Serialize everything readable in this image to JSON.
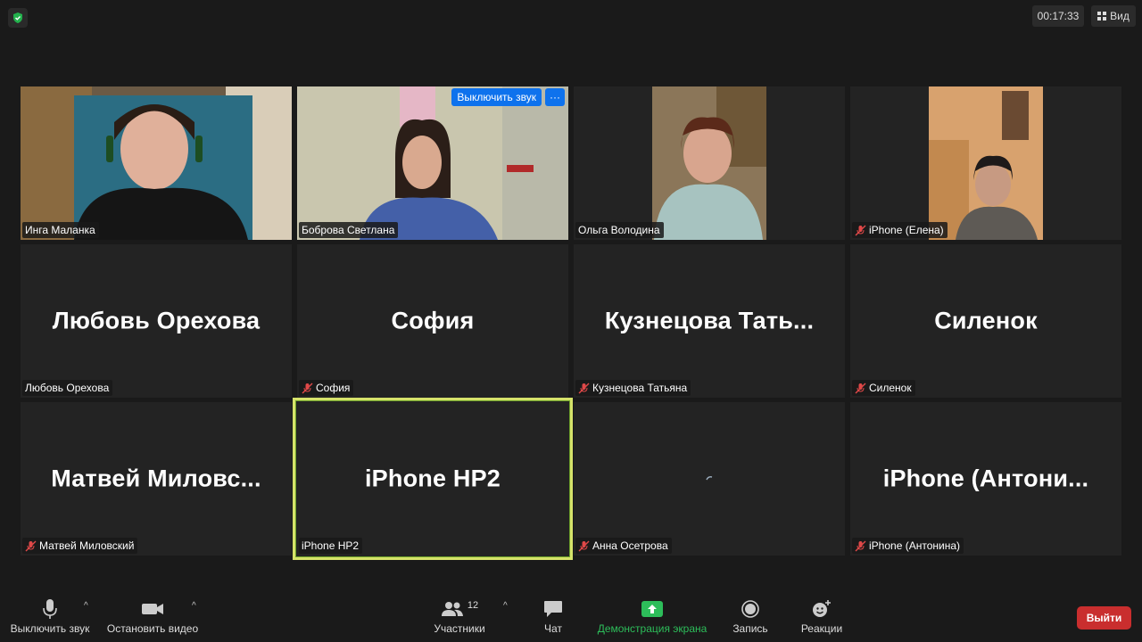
{
  "meeting": {
    "timer": "00:17:33",
    "view_label": "Вид"
  },
  "tiles": [
    {
      "big": "",
      "label": "Инга Маланка",
      "muted": false,
      "video": true
    },
    {
      "big": "",
      "label": "Боброва Светлана",
      "muted": false,
      "video": true,
      "mute_button": "Выключить звук",
      "more_button": "···"
    },
    {
      "big": "",
      "label": "Ольга Володина",
      "muted": false,
      "video": true
    },
    {
      "big": "",
      "label": "iPhone (Елена)",
      "muted": true,
      "video": true
    },
    {
      "big": "Любовь Орехова",
      "label": "Любовь Орехова",
      "muted": false
    },
    {
      "big": "София",
      "label": "София",
      "muted": true
    },
    {
      "big": "Кузнецова  Тать...",
      "label": "Кузнецова Татьяна",
      "muted": true
    },
    {
      "big": "Силенок",
      "label": "Силенок",
      "muted": true
    },
    {
      "big": "Матвей  Миловс...",
      "label": "Матвей Миловский",
      "muted": true
    },
    {
      "big": "iPhone HP2",
      "label": "iPhone HP2",
      "muted": false
    },
    {
      "big": "",
      "label": "Анна Осетрова",
      "muted": true
    },
    {
      "big": "iPhone  (Антони...",
      "label": "iPhone (Антонина)",
      "muted": true
    }
  ],
  "toolbar": {
    "mute": "Выключить звук",
    "video": "Остановить видео",
    "participants": "Участники",
    "participants_count": "12",
    "chat": "Чат",
    "share": "Демонстрация экрана",
    "record": "Запись",
    "reactions": "Реакции",
    "leave": "Выйти"
  },
  "colors": {
    "accent_blue": "#0e72ed",
    "share_green": "#2dbd5a",
    "leave_red": "#c92e2e",
    "active_speaker": "#d6e36a"
  }
}
